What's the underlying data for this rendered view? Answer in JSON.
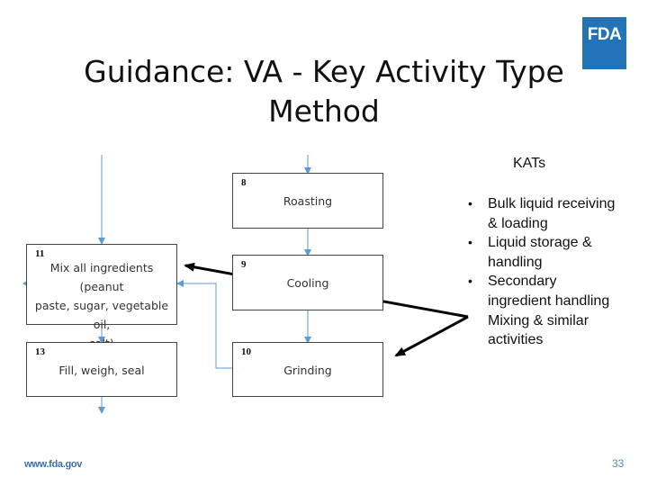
{
  "slide": {
    "title": "Guidance: VA - Key Activity Type Method",
    "title_line1": "Guidance: VA - Key Activity Type",
    "title_line2": "Method",
    "logo_text": "FDA",
    "logo_color": "#2274b7",
    "footer_url": "www.fda.gov",
    "page_number": "33"
  },
  "flowchart": {
    "steps": [
      {
        "id": "8",
        "label": "Roasting"
      },
      {
        "id": "9",
        "label": "Cooling"
      },
      {
        "id": "10",
        "label": "Grinding"
      },
      {
        "id": "11",
        "label": "Mix all ingredients (peanut paste, sugar, vegetable oil, salt)",
        "lines": [
          "Mix all ingredients (peanut",
          "paste, sugar, vegetable oil,",
          "salt)"
        ]
      },
      {
        "id": "13",
        "label": "Fill, weigh, seal"
      }
    ],
    "connector_color": "#5b9bd5"
  },
  "kats": {
    "heading": "KATs",
    "items": [
      {
        "text": "Bulk liquid receiving & loading",
        "lines": [
          "Bulk liquid receiving",
          "& loading"
        ],
        "bullet": "•"
      },
      {
        "text": "Liquid storage & handling",
        "lines": [
          "Liquid storage &",
          "handling"
        ],
        "bullet": "•"
      },
      {
        "text": "Secondary ingredient handling",
        "lines": [
          "Secondary",
          "ingredient handling"
        ],
        "bullet": "•"
      },
      {
        "text": "Mixing & similar activities",
        "lines": [
          "Mixing & similar",
          "activities"
        ],
        "bullet": ""
      }
    ]
  }
}
